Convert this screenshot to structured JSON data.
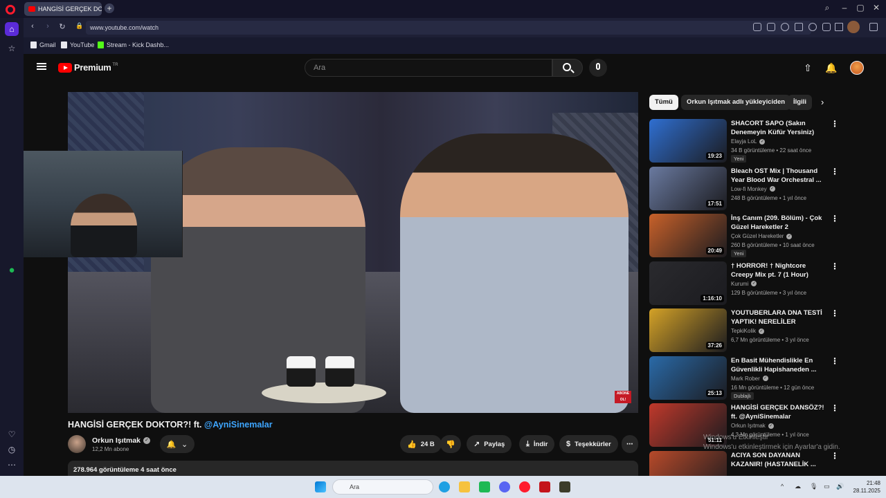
{
  "browser": {
    "tab_title": "HANGİSİ GERÇEK DO",
    "url": "www.youtube.com/watch",
    "bookmarks": [
      "Gmail",
      "YouTube",
      "Stream - Kick Dashb..."
    ]
  },
  "yt": {
    "brand": "Premium",
    "region": "TR",
    "search_placeholder": "Ara"
  },
  "video": {
    "title": "HANGİSİ GERÇEK DOKTOR?! ft. ",
    "mention": "@AyniSinemalar",
    "overlay_badge": "ABONE OL!",
    "channel": "Orkun Işıtmak",
    "subscribers": "12,2 Mn abone",
    "likes": "24 B",
    "share": "Paylaş",
    "download": "İndir",
    "thanks": "Teşekkürler",
    "views_line": "278.964 görüntüleme  4 saat önce"
  },
  "chips": [
    "Tümü",
    "Orkun Işıtmak adlı yükleyiciden",
    "İlgili"
  ],
  "recommendations": [
    {
      "title": "SHACORT SAPO (Sakın Denemeyin Küfür Yersiniz)",
      "channel": "Elayja LoL",
      "meta": "34 B görüntüleme • 22 saat önce",
      "badge": "Yeni",
      "duration": "19:23",
      "color": "#2f6fd1"
    },
    {
      "title": "Bleach OST Mix | Thousand Year Blood War Orchestral ...",
      "channel": "Low-fi Monkey",
      "meta": "248 B görüntüleme • 1 yıl önce",
      "badge": "",
      "duration": "17:51",
      "color": "#6a7aa0"
    },
    {
      "title": "İnş Canım (209. Bölüm) - Çok Güzel Hareketler 2",
      "channel": "Çok Güzel Hareketler",
      "meta": "260 B görüntüleme • 10 saat önce",
      "badge": "Yeni",
      "duration": "20:49",
      "color": "#c8612a"
    },
    {
      "title": "† HORROR! † Nightcore Creepy Mix pt. 7 (1 Hour)",
      "channel": "Kurumi",
      "meta": "129 B görüntüleme • 3 yıl önce",
      "badge": "",
      "duration": "1:16:10",
      "color": "#2a2a2e"
    },
    {
      "title": "YOUTUBERLARA DNA TESTİ YAPTIK! NERELİLER ÖĞRENDİK!",
      "channel": "TepkiKolik",
      "meta": "6,7 Mn görüntüleme • 3 yıl önce",
      "badge": "",
      "duration": "37:26",
      "color": "#d4a227"
    },
    {
      "title": "En Basit Mühendislikle En Güvenlikli Hapishaneden ...",
      "channel": "Mark Rober",
      "meta": "16 Mn görüntüleme • 12 gün önce",
      "badge": "Dublajlı",
      "duration": "25:13",
      "color": "#2a6aa8"
    },
    {
      "title": "HANGİSİ GERÇEK DANSÖZ?! ft. @AyniSinemalar",
      "channel": "Orkun Işıtmak",
      "meta": "4,3 Mn görüntüleme • 1 yıl önce",
      "badge": "",
      "duration": "51:11",
      "color": "#c0392b"
    },
    {
      "title": "ACIYA SON DAYANAN KAZANIR! (HASTANELİK ...",
      "channel": "",
      "meta": "",
      "badge": "",
      "duration": "",
      "color": "#b84a2a"
    }
  ],
  "watermark": {
    "line1": "Windows'u Etkinleştir",
    "line2": "Windows'u etkinleştirmek için Ayarlar'a gidin."
  },
  "taskbar": {
    "search_placeholder": "Ara",
    "time": "21:48",
    "date": "28.11.2025"
  }
}
